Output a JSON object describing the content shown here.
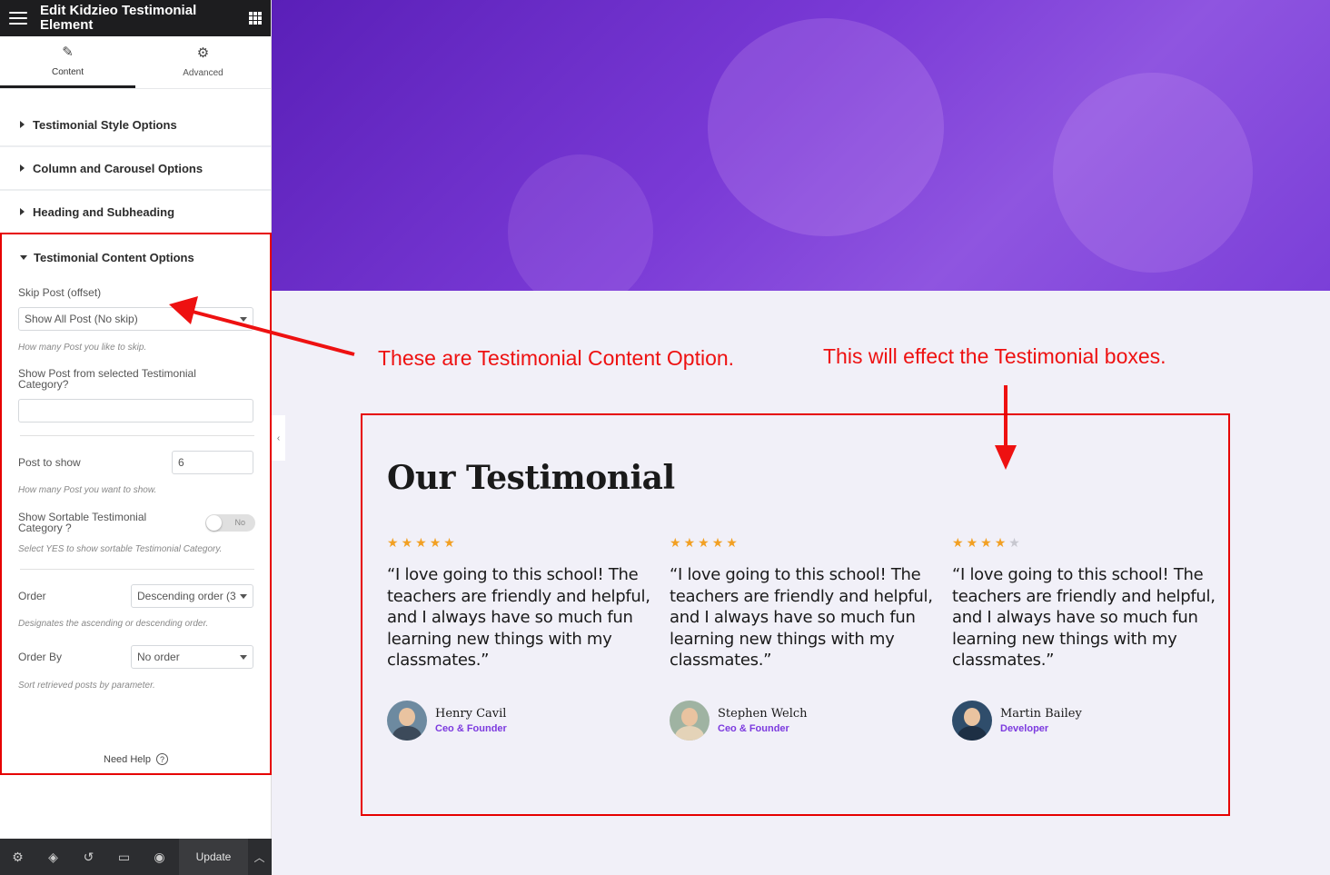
{
  "sidebar": {
    "header_title": "Edit Kidzieo Testimonial Element",
    "tabs": [
      {
        "label": "Content",
        "icon": "pencil-icon"
      },
      {
        "label": "Advanced",
        "icon": "gear-icon"
      }
    ],
    "sections": [
      "Testimonial Style Options",
      "Column and Carousel Options",
      "Heading and Subheading"
    ],
    "content_options": {
      "title": "Testimonial Content Options",
      "skip_post_label": "Skip Post (offset)",
      "skip_post_value": "Show All Post (No skip)",
      "skip_post_hint": "How many Post you like to skip.",
      "category_label": "Show Post from selected Testimonial Category?",
      "category_value": "",
      "post_to_show_label": "Post to show",
      "post_to_show_value": "6",
      "post_to_show_hint": "How many Post you want to show.",
      "sortable_label": "Show Sortable Testimonial Category ?",
      "sortable_toggle": "No",
      "sortable_hint": "Select YES to show sortable Testimonial Category.",
      "order_label": "Order",
      "order_value": "Descending order (3",
      "order_hint": "Designates the ascending or descending order.",
      "orderby_label": "Order By",
      "orderby_value": "No order",
      "orderby_hint": "Sort retrieved posts by parameter.",
      "need_help": "Need Help",
      "help_icon_char": "?"
    },
    "footer": {
      "update_label": "Update"
    }
  },
  "annotations": {
    "left": "These are Testimonial Content Option.",
    "right": "This will effect the Testimonial boxes."
  },
  "testimonials": {
    "title": "Our Testimonial",
    "cards": [
      {
        "stars_filled": 5,
        "stars_total": 5,
        "quote": "“I love going to this school! The teachers are friendly and helpful, and I always have so much fun learning new things with my classmates.”",
        "name": "Henry Cavil",
        "role": "Ceo & Founder"
      },
      {
        "stars_filled": 5,
        "stars_total": 5,
        "quote": "“I love going to this school! The teachers are friendly and helpful, and I always have so much fun learning new things with my classmates.”",
        "name": "Stephen Welch",
        "role": "Ceo & Founder"
      },
      {
        "stars_filled": 4,
        "stars_total": 5,
        "quote": "“I love going to this school! The teachers are friendly and helpful, and I always have so much fun learning new things with my classmates.”",
        "name": "Martin Bailey",
        "role": "Developer"
      }
    ]
  },
  "colors": {
    "accent_purple": "#7c3adf",
    "star": "#f2a023",
    "annotation_red": "#ee1111"
  }
}
